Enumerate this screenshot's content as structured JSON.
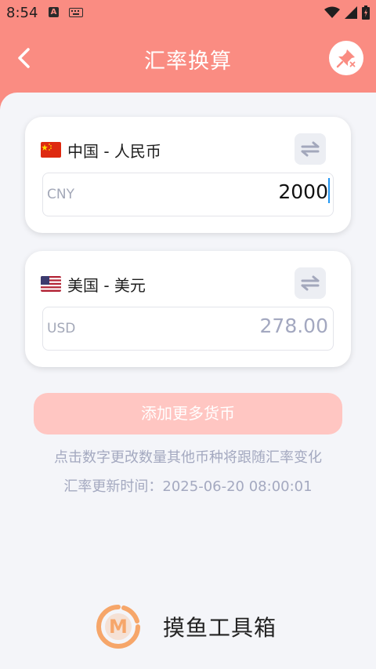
{
  "status_bar": {
    "time": "8:54",
    "a_badge": "A",
    "icons": [
      "keyboard-icon",
      "wifi-icon",
      "signal-icon",
      "battery-icon"
    ]
  },
  "header": {
    "title": "汇率换算",
    "back_icon": "chevron-left-icon",
    "action_icon": "pin-off-icon"
  },
  "cards": [
    {
      "flag": "cn-flag-icon",
      "name": "中国 - 人民币",
      "code": "CNY",
      "amount": "2000",
      "active": true
    },
    {
      "flag": "us-flag-icon",
      "name": "美国 - 美元",
      "code": "USD",
      "amount": "278.00",
      "active": false
    }
  ],
  "add_button_label": "添加更多货币",
  "hint_text": "点击数字更改数量其他币种将跟随汇率变化",
  "update_time": "汇率更新时间：2025-06-20 08:00:01",
  "brand": {
    "name": "摸鱼工具箱",
    "logo_letter": "M"
  },
  "colors": {
    "header": "#fa8c82",
    "background": "#f4f5f9",
    "button_disabled": "#ffc6c2",
    "logo": "#f6a66a",
    "caret": "#2196f3"
  }
}
